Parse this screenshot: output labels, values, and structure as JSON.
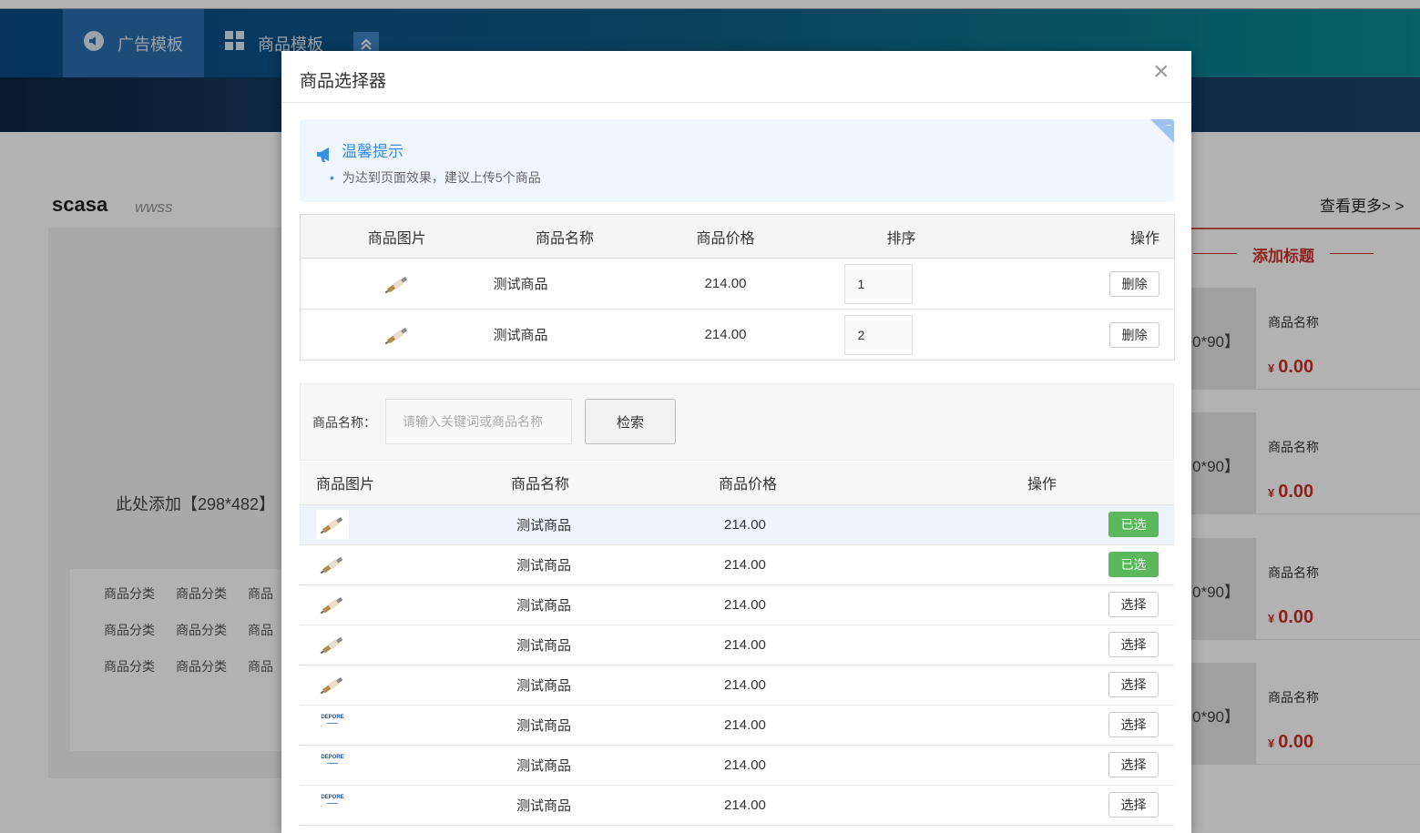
{
  "nav": {
    "tabs": [
      {
        "label": "广告模板",
        "icon": "megaphone-circle-icon"
      },
      {
        "label": "商品模板",
        "icon": "grid-icon"
      }
    ],
    "collapse_icon": "double-chevron-up-icon"
  },
  "background": {
    "section_title": "scasa",
    "section_subtitle": "wwss",
    "add_big_label": "此处添加【298*482】",
    "category_rows": [
      [
        "商品分类",
        "商品分类",
        "商品"
      ],
      [
        "商品分类",
        "商品分类",
        "商品"
      ],
      [
        "商品分类",
        "商品分类",
        "商品"
      ]
    ],
    "more_link": "查看更多> >",
    "add_title": "添加标题",
    "products": [
      {
        "size": "0*90】",
        "name": "商品名称",
        "currency": "¥",
        "price": "0.00"
      },
      {
        "size": "0*90】",
        "name": "商品名称",
        "currency": "¥",
        "price": "0.00"
      },
      {
        "size": "0*90】",
        "name": "商品名称",
        "currency": "¥",
        "price": "0.00"
      },
      {
        "size": "0*90】",
        "name": "商品名称",
        "currency": "¥",
        "price": "0.00"
      }
    ]
  },
  "modal": {
    "title": "商品选择器",
    "close_icon": "close-icon",
    "tip": {
      "title": "温馨提示",
      "icon": "megaphone-icon",
      "line": "为达到页面效果，建议上传5个商品"
    },
    "selected_table": {
      "headers": [
        "商品图片",
        "商品名称",
        "商品价格",
        "排序",
        "操作"
      ],
      "rows": [
        {
          "name": "测试商品",
          "price": "214.00",
          "sort": "1",
          "action": "删除"
        },
        {
          "name": "测试商品",
          "price": "214.00",
          "sort": "2",
          "action": "删除"
        }
      ]
    },
    "search": {
      "label": "商品名称：",
      "placeholder": "请输入关键词或商品名称",
      "button": "检索"
    },
    "list_table": {
      "headers": [
        "商品图片",
        "商品名称",
        "商品价格",
        "操作"
      ],
      "rows": [
        {
          "thumb": "spark-plug",
          "name": "测试商品",
          "price": "214.00",
          "action": "已选",
          "selected": true
        },
        {
          "thumb": "spark-plug",
          "name": "测试商品",
          "price": "214.00",
          "action": "已选",
          "selected": true
        },
        {
          "thumb": "spark-plug",
          "name": "测试商品",
          "price": "214.00",
          "action": "选择",
          "selected": false
        },
        {
          "thumb": "spark-plug",
          "name": "测试商品",
          "price": "214.00",
          "action": "选择",
          "selected": false
        },
        {
          "thumb": "spark-plug",
          "name": "测试商品",
          "price": "214.00",
          "action": "选择",
          "selected": false
        },
        {
          "thumb": "logo",
          "name": "测试商品",
          "price": "214.00",
          "action": "选择",
          "selected": false
        },
        {
          "thumb": "logo",
          "name": "测试商品",
          "price": "214.00",
          "action": "选择",
          "selected": false
        },
        {
          "thumb": "logo",
          "name": "测试商品",
          "price": "214.00",
          "action": "选择",
          "selected": false
        }
      ],
      "logo_text": "DEPORE"
    }
  },
  "colors": {
    "accent_blue": "#3a8ee6",
    "selected_green": "#5cb85c",
    "price_red": "#c9302c"
  }
}
